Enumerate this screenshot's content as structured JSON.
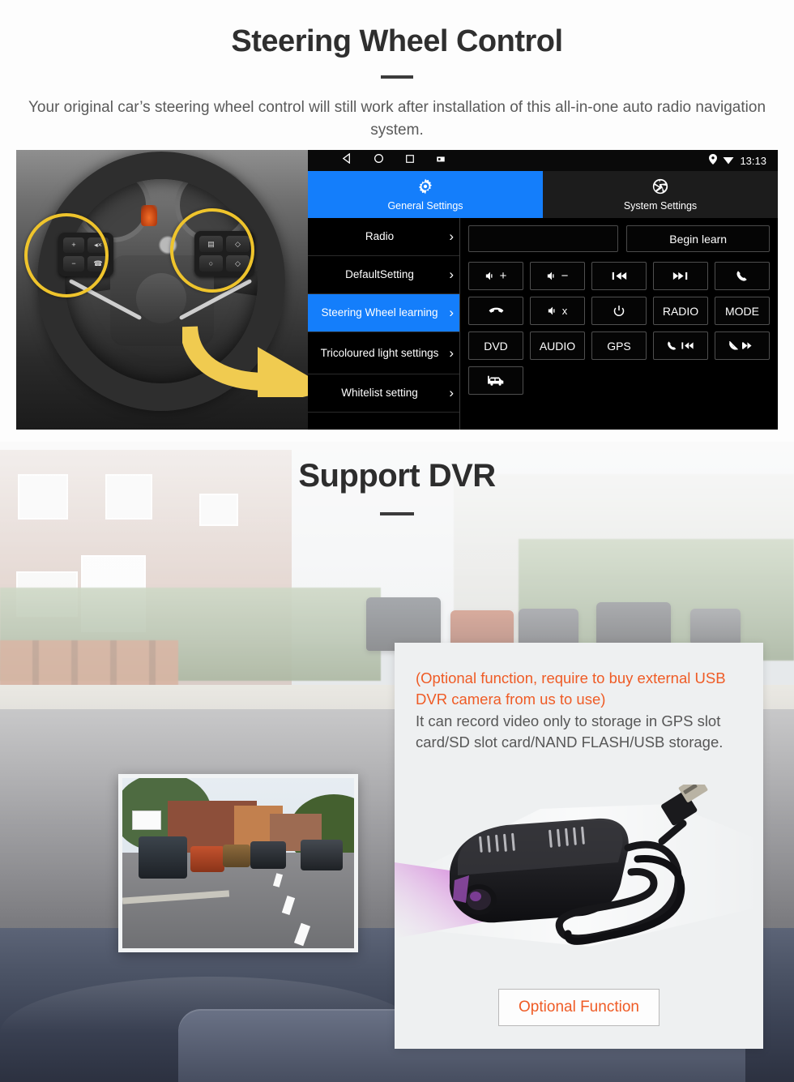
{
  "section_swc": {
    "title": "Steering Wheel Control",
    "subtitle": "Your original car’s steering wheel control will still work after installation of this all-in-one auto radio navigation system.",
    "photo": {
      "name": "steering-wheel-photo",
      "alt": "Grayscale photo of a car steering wheel with two highlighted multifunction button pads",
      "highlight_color": "#f5c518",
      "arrow_color": "#f5cb3f",
      "left_pad_keys": [
        "+",
        "◂×",
        "−",
        "☎"
      ],
      "right_pad_keys": [
        "▤",
        "◇",
        "○",
        "◇"
      ]
    },
    "android": {
      "statusbar": {
        "nav_icons": [
          "back-icon",
          "home-icon",
          "recents-icon",
          "screenshot-icon"
        ],
        "status_icons": [
          "location-pin-icon",
          "wifi-icon"
        ],
        "time": "13:13"
      },
      "tabs": [
        {
          "label": "General Settings",
          "icon": "gear-icon",
          "active": true
        },
        {
          "label": "System Settings",
          "icon": "aperture-icon",
          "active": false
        }
      ],
      "menu": [
        {
          "label": "Radio",
          "selected": false
        },
        {
          "label": "DefaultSetting",
          "selected": false
        },
        {
          "label": "Steering Wheel learning",
          "selected": true
        },
        {
          "label": "Tricoloured light settings",
          "selected": false
        },
        {
          "label": "Whitelist setting",
          "selected": false
        }
      ],
      "learn": {
        "field_value": "",
        "field_placeholder": "",
        "begin_button": "Begin learn",
        "keys": [
          {
            "label": "",
            "icon": "volume-up-icon"
          },
          {
            "label": "",
            "icon": "volume-down-icon"
          },
          {
            "label": "",
            "icon": "previous-track-icon"
          },
          {
            "label": "",
            "icon": "next-track-icon"
          },
          {
            "label": "",
            "icon": "call-icon"
          },
          {
            "label": "",
            "icon": "hang-up-icon"
          },
          {
            "label": "",
            "icon": "mute-icon"
          },
          {
            "label": "",
            "icon": "power-icon"
          },
          {
            "label": "RADIO",
            "icon": ""
          },
          {
            "label": "MODE",
            "icon": ""
          },
          {
            "label": "DVD",
            "icon": ""
          },
          {
            "label": "AUDIO",
            "icon": ""
          },
          {
            "label": "GPS",
            "icon": ""
          },
          {
            "label": "",
            "icon": "call-previous-icon"
          },
          {
            "label": "",
            "icon": "hangup-next-icon"
          },
          {
            "label": "",
            "icon": "car-icon"
          }
        ]
      },
      "colors": {
        "accent": "#147efb",
        "background": "#000000"
      }
    }
  },
  "section_dvr": {
    "title": "Support DVR",
    "background_alt": "Faded dashcam view of a residential street with parked cars, seen over a car dashboard",
    "preview": {
      "name": "dashcam-video-preview",
      "alt": "Dashcam still frame showing traffic on a suburban road with lane markings"
    },
    "card": {
      "highlight_text": "(Optional function, require to buy external USB DVR camera from us to use)",
      "body_text": "It can record video only to storage in GPS slot card/SD slot card/NAND FLASH/USB storage.",
      "device_alt": "Black USB DVR dash camera with coiled USB cable",
      "button_label": "Optional Function",
      "highlight_color": "#ef5b25",
      "body_color": "#575757",
      "background": "#eef0f1"
    }
  }
}
